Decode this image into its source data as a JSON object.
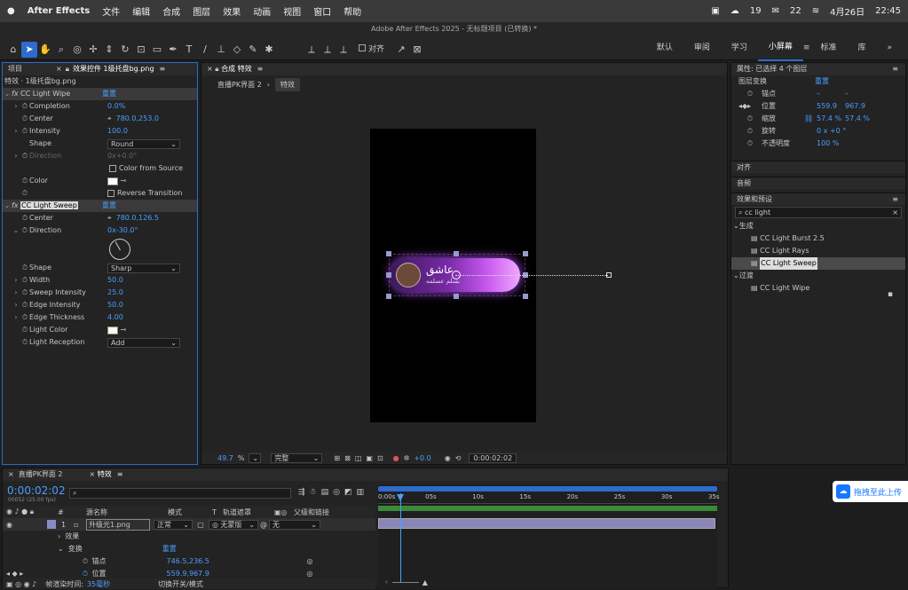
{
  "menubar": {
    "app": "After Effects",
    "items": [
      "文件",
      "编辑",
      "合成",
      "图层",
      "效果",
      "动画",
      "视图",
      "窗口",
      "帮助"
    ],
    "status": [
      "19",
      "22"
    ],
    "date": "4月26日",
    "time": "22:45"
  },
  "titlebar": "Adobe After Effects 2025 - 无标题项目 (已转换) *",
  "toolbar": {
    "snap_label": "对齐",
    "workspaces": [
      "默认",
      "审阅",
      "学习",
      "小屏幕",
      "标准",
      "库"
    ],
    "active_ws": "小屏幕"
  },
  "project_panel": {
    "tab_project": "项目",
    "tab_effects": "效果控件 1级托盘bg.png",
    "breadcrumb": "特效 · 1级托盘bg.png"
  },
  "effects": {
    "wipe": {
      "name": "CC Light Wipe",
      "reset": "重置",
      "completion_label": "Completion",
      "completion": "0.0%",
      "center_label": "Center",
      "center": "780.0,253.0",
      "intensity_label": "Intensity",
      "intensity": "100.0",
      "shape_label": "Shape",
      "shape": "Round",
      "direction_label": "Direction",
      "direction": "0x+0.0°",
      "color_from_source": "Color from Source",
      "color_label": "Color",
      "reverse": "Reverse Transition"
    },
    "sweep": {
      "name": "CC Light Sweep",
      "reset": "重置",
      "center_label": "Center",
      "center": "780.0,126.5",
      "direction_label": "Direction",
      "direction": "0x-30.0°",
      "shape_label": "Shape",
      "shape": "Sharp",
      "width_label": "Width",
      "width": "50.0",
      "sweep_intensity_label": "Sweep Intensity",
      "sweep_intensity": "25.0",
      "edge_intensity_label": "Edge Intensity",
      "edge_intensity": "50.0",
      "edge_thickness_label": "Edge Thickness",
      "edge_thickness": "4.00",
      "light_color_label": "Light Color",
      "light_reception_label": "Light Reception",
      "light_reception": "Add"
    }
  },
  "comp": {
    "tab": "合成 特效",
    "crumb1": "直播PK界面 2",
    "crumb2": "特效",
    "badge_title": "عاشق",
    "badge_sub": "بسلم عسلمه",
    "zoom": "49.7",
    "zoom_unit": "%",
    "quality": "完整",
    "exposure": "+0.0",
    "timecode": "0:00:02:02"
  },
  "properties": {
    "title": "属性: 已选择 4 个图层",
    "section": "图层变换",
    "reset": "重置",
    "anchor": "锚点",
    "anchor_v1": "–",
    "anchor_v2": "–",
    "position": "位置",
    "pos_x": "559.9",
    "pos_y": "967.9",
    "scale": "缩放",
    "scale_x": "57.4 %",
    "scale_y": "57.4 %",
    "rotation": "旋转",
    "rotation_v": "0 x +0 °",
    "opacity": "不透明度",
    "opacity_v": "100 %"
  },
  "right_sections": {
    "align": "对齐",
    "audio": "音频",
    "effects_presets": "效果和预设"
  },
  "effects_presets": {
    "search": "cc light",
    "group1": "生成",
    "items1": [
      "CC Light Burst 2.5",
      "CC Light Rays",
      "CC Light Sweep"
    ],
    "group2": "过渡",
    "items2": [
      "CC Light Wipe"
    ],
    "selected": "CC Light Sweep"
  },
  "timeline": {
    "tab1": "直播PK界面 2",
    "tab2": "特效",
    "timecode": "0:00:02:02",
    "sub_tc": "00052 (25.00 fps)",
    "col_source": "源名称",
    "col_mode": "模式",
    "col_t": "T",
    "col_matte": "轨道遮罩",
    "col_parent": "父级和链接",
    "layer_num": "1",
    "layer_name": "升级光1.png",
    "layer_mode": "正常",
    "layer_matte": "无蒙版",
    "layer_parent": "无",
    "effects_row": "效果",
    "transform_row": "变换",
    "transform_reset": "重置",
    "anchor_row": "锚点",
    "anchor_val": "746.5,236.5",
    "position_row": "位置",
    "position_val": "559.9,967.9",
    "render_label": "帧渲染时间:",
    "render_val": "35毫秒",
    "toggle_label": "切换开关/模式",
    "ruler": [
      "0:00s",
      "05s",
      "10s",
      "15s",
      "20s",
      "25s",
      "30s",
      "35s"
    ]
  },
  "upload_btn": "拖拽至此上传"
}
